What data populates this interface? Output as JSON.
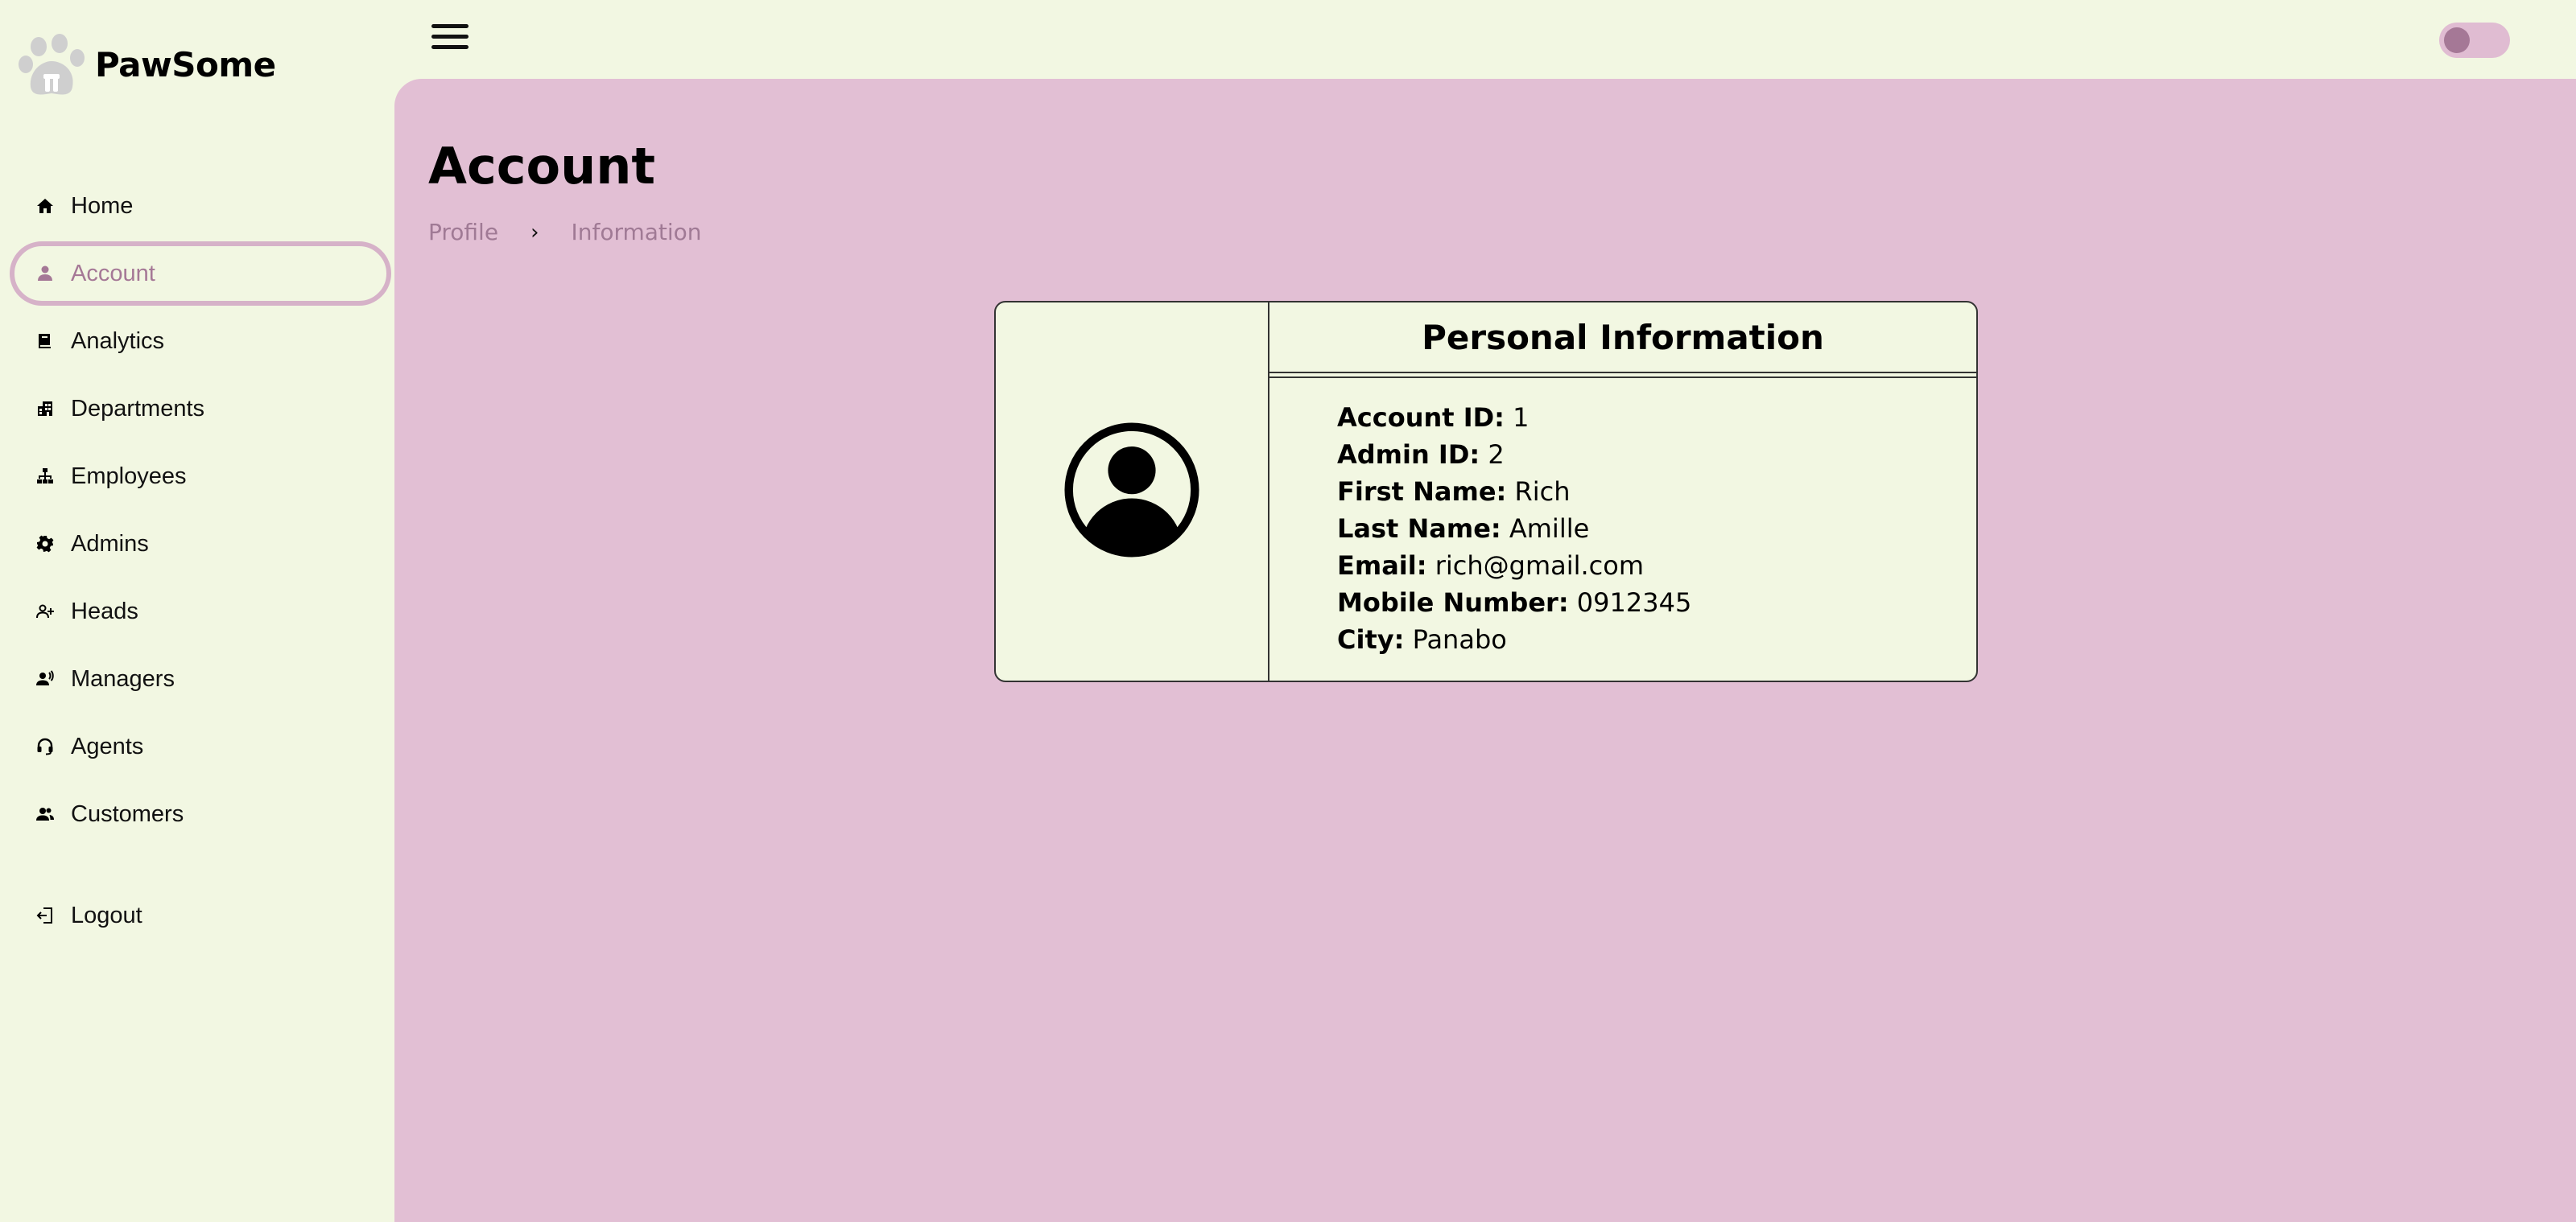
{
  "brand": {
    "name": "PawSome",
    "logo": "paw-print-logo"
  },
  "nav": [
    {
      "label": "Home",
      "icon": "home-icon"
    },
    {
      "label": "Account",
      "icon": "person-icon",
      "active": true
    },
    {
      "label": "Analytics",
      "icon": "book-icon"
    },
    {
      "label": "Departments",
      "icon": "building-icon"
    },
    {
      "label": "Employees",
      "icon": "org-chart-icon"
    },
    {
      "label": "Admins",
      "icon": "gear-icon"
    },
    {
      "label": "Heads",
      "icon": "person-add-icon"
    },
    {
      "label": "Managers",
      "icon": "speaker-person-icon"
    },
    {
      "label": "Agents",
      "icon": "headset-icon"
    },
    {
      "label": "Customers",
      "icon": "people-icon"
    }
  ],
  "logout": {
    "label": "Logout",
    "icon": "logout-icon"
  },
  "page": {
    "title": "Account",
    "breadcrumb": [
      "Profile",
      "Information"
    ]
  },
  "card": {
    "title": "Personal Information",
    "fields": [
      {
        "key": "Account ID:",
        "value": "1"
      },
      {
        "key": "Admin ID:",
        "value": "2"
      },
      {
        "key": "First Name:",
        "value": "Rich"
      },
      {
        "key": "Last Name:",
        "value": "Amille"
      },
      {
        "key": "Email:",
        "value": "rich@gmail.com"
      },
      {
        "key": "Mobile Number:",
        "value": "0912345"
      },
      {
        "key": "City:",
        "value": "Panabo"
      }
    ]
  },
  "colors": {
    "sidebar_bg": "#f2f7e2",
    "main_bg": "#e2bfd4",
    "accent": "#a57896",
    "active_border": "#d6b2c8"
  }
}
